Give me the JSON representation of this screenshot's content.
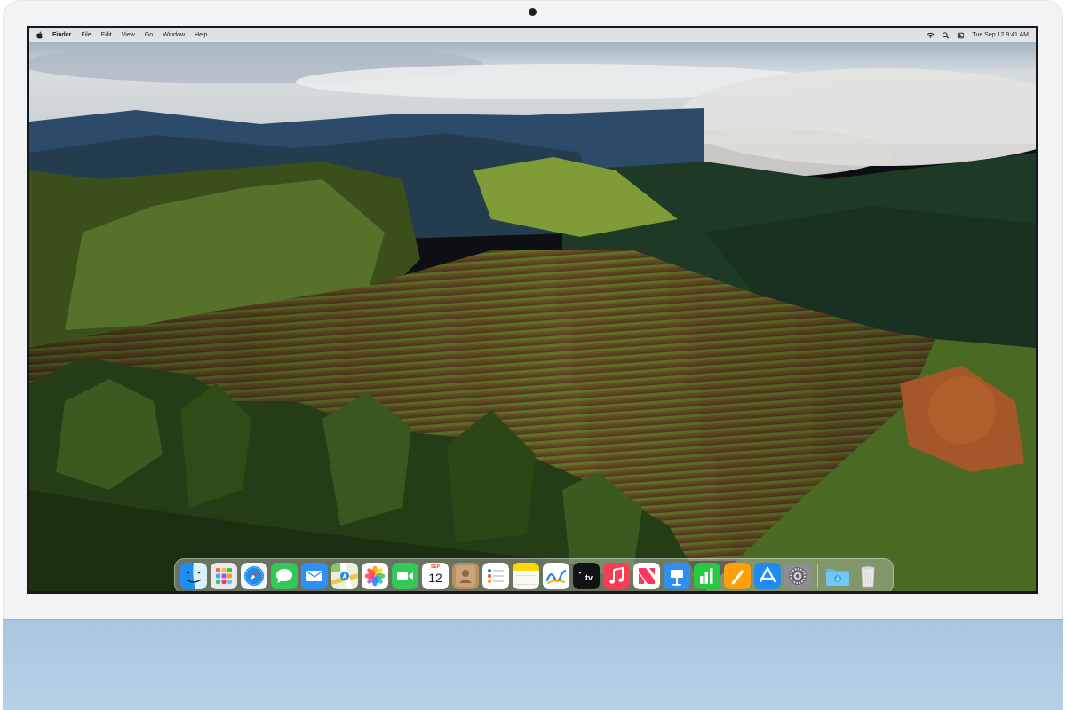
{
  "menubar": {
    "app_name": "Finder",
    "menus": [
      "File",
      "Edit",
      "View",
      "Go",
      "Window",
      "Help"
    ],
    "clock": "Tue Sep 12  9:41 AM"
  },
  "dock": {
    "apps": [
      {
        "name": "Finder",
        "icon": "finder-icon"
      },
      {
        "name": "Launchpad",
        "icon": "launchpad-icon"
      },
      {
        "name": "Safari",
        "icon": "safari-icon"
      },
      {
        "name": "Messages",
        "icon": "messages-icon"
      },
      {
        "name": "Mail",
        "icon": "mail-icon"
      },
      {
        "name": "Maps",
        "icon": "maps-icon"
      },
      {
        "name": "Photos",
        "icon": "photos-icon"
      },
      {
        "name": "FaceTime",
        "icon": "facetime-icon"
      },
      {
        "name": "Calendar",
        "icon": "calendar-icon"
      },
      {
        "name": "Contacts",
        "icon": "contacts-icon"
      },
      {
        "name": "Reminders",
        "icon": "reminders-icon"
      },
      {
        "name": "Notes",
        "icon": "notes-icon"
      },
      {
        "name": "Freeform",
        "icon": "freeform-icon"
      },
      {
        "name": "TV",
        "icon": "tv-icon"
      },
      {
        "name": "Music",
        "icon": "music-icon"
      },
      {
        "name": "News",
        "icon": "news-icon"
      },
      {
        "name": "Keynote",
        "icon": "keynote-icon"
      },
      {
        "name": "Numbers",
        "icon": "numbers-icon"
      },
      {
        "name": "Pages",
        "icon": "pages-icon"
      },
      {
        "name": "App Store",
        "icon": "app-store-icon"
      },
      {
        "name": "System Settings",
        "icon": "system-settings-icon"
      }
    ],
    "extras": [
      {
        "name": "Downloads",
        "icon": "downloads-folder-icon"
      },
      {
        "name": "Trash",
        "icon": "trash-icon"
      }
    ],
    "calendar_month": "SEP",
    "calendar_day": "12",
    "tv_label": "tv"
  },
  "colors": {
    "chin": "#b3cde5",
    "menubar": "#eeeef0",
    "dock": "#d2d4d0"
  }
}
